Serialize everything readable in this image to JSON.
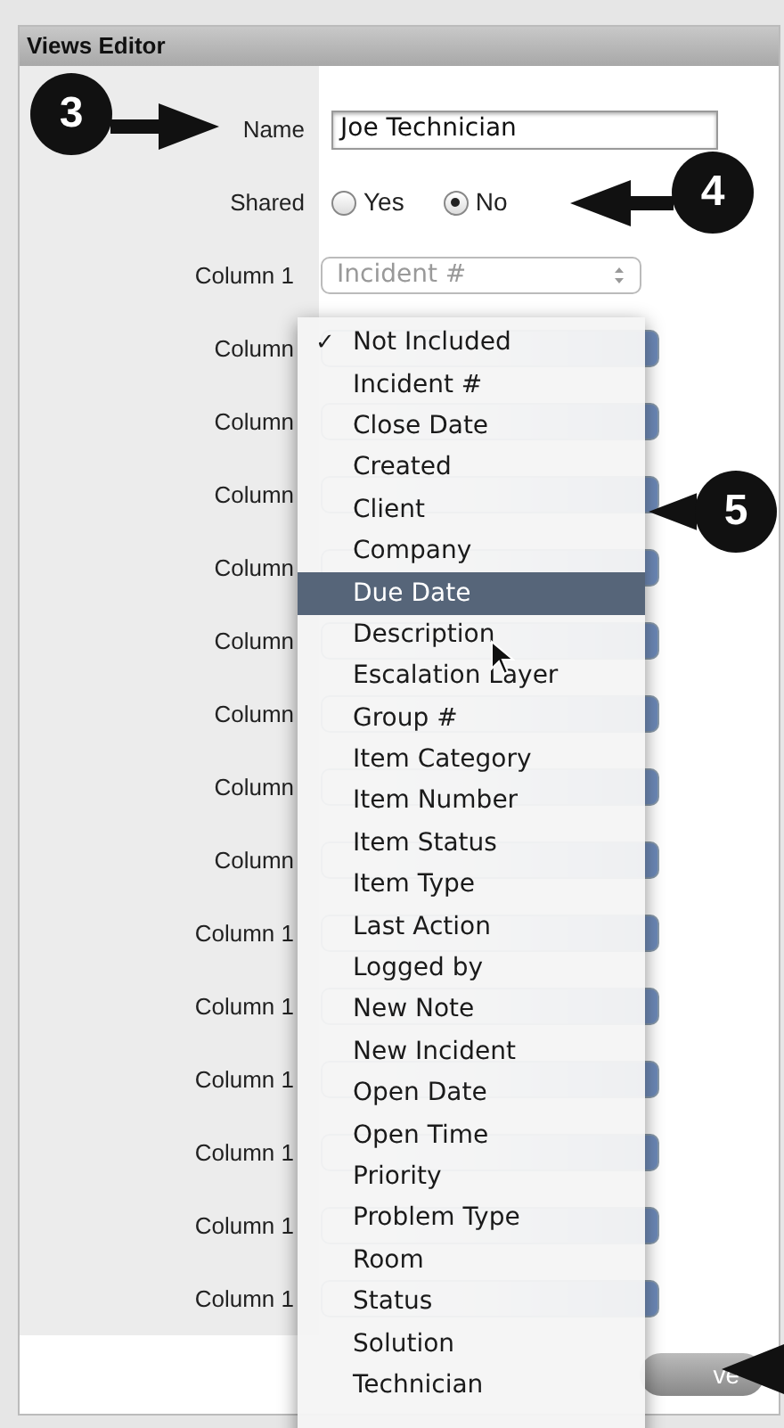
{
  "panel": {
    "title": "Views Editor"
  },
  "form": {
    "name_label": "Name",
    "name_value": "Joe Technician",
    "shared_label": "Shared",
    "shared_options": [
      {
        "label": "Yes",
        "selected": false
      },
      {
        "label": "No",
        "selected": true
      }
    ],
    "columns": [
      {
        "label": "Column 1",
        "value": "Incident #"
      },
      {
        "label": "Column"
      },
      {
        "label": "Column"
      },
      {
        "label": "Column"
      },
      {
        "label": "Column"
      },
      {
        "label": "Column"
      },
      {
        "label": "Column"
      },
      {
        "label": "Column"
      },
      {
        "label": "Column"
      },
      {
        "label": "Column 1"
      },
      {
        "label": "Column 1"
      },
      {
        "label": "Column 1"
      },
      {
        "label": "Column 1"
      },
      {
        "label": "Column 1"
      },
      {
        "label": "Column 1"
      }
    ]
  },
  "save_button": {
    "label": "ve"
  },
  "menu": {
    "items": [
      {
        "label": "Not Included",
        "checked": true,
        "selected": false
      },
      {
        "label": "Incident #",
        "checked": false,
        "selected": false
      },
      {
        "label": "Close Date",
        "checked": false,
        "selected": false
      },
      {
        "label": "Created",
        "checked": false,
        "selected": false
      },
      {
        "label": "Client",
        "checked": false,
        "selected": false
      },
      {
        "label": "Company",
        "checked": false,
        "selected": false
      },
      {
        "label": "Due Date",
        "checked": false,
        "selected": true
      },
      {
        "label": "Description",
        "checked": false,
        "selected": false
      },
      {
        "label": "Escalation Layer",
        "checked": false,
        "selected": false
      },
      {
        "label": "Group #",
        "checked": false,
        "selected": false
      },
      {
        "label": "Item Category",
        "checked": false,
        "selected": false
      },
      {
        "label": "Item Number",
        "checked": false,
        "selected": false
      },
      {
        "label": "Item Status",
        "checked": false,
        "selected": false
      },
      {
        "label": "Item Type",
        "checked": false,
        "selected": false
      },
      {
        "label": "Last Action",
        "checked": false,
        "selected": false
      },
      {
        "label": "Logged by",
        "checked": false,
        "selected": false
      },
      {
        "label": "New Note",
        "checked": false,
        "selected": false
      },
      {
        "label": "New Incident",
        "checked": false,
        "selected": false
      },
      {
        "label": "Open Date",
        "checked": false,
        "selected": false
      },
      {
        "label": "Open Time",
        "checked": false,
        "selected": false
      },
      {
        "label": "Priority",
        "checked": false,
        "selected": false
      },
      {
        "label": "Problem Type",
        "checked": false,
        "selected": false
      },
      {
        "label": "Room",
        "checked": false,
        "selected": false
      },
      {
        "label": "Status",
        "checked": false,
        "selected": false
      },
      {
        "label": "Solution",
        "checked": false,
        "selected": false
      },
      {
        "label": "Technician",
        "checked": false,
        "selected": false
      }
    ],
    "check_mark": "✓"
  },
  "callouts": [
    {
      "label": "3"
    },
    {
      "label": "4"
    },
    {
      "label": "5"
    }
  ]
}
